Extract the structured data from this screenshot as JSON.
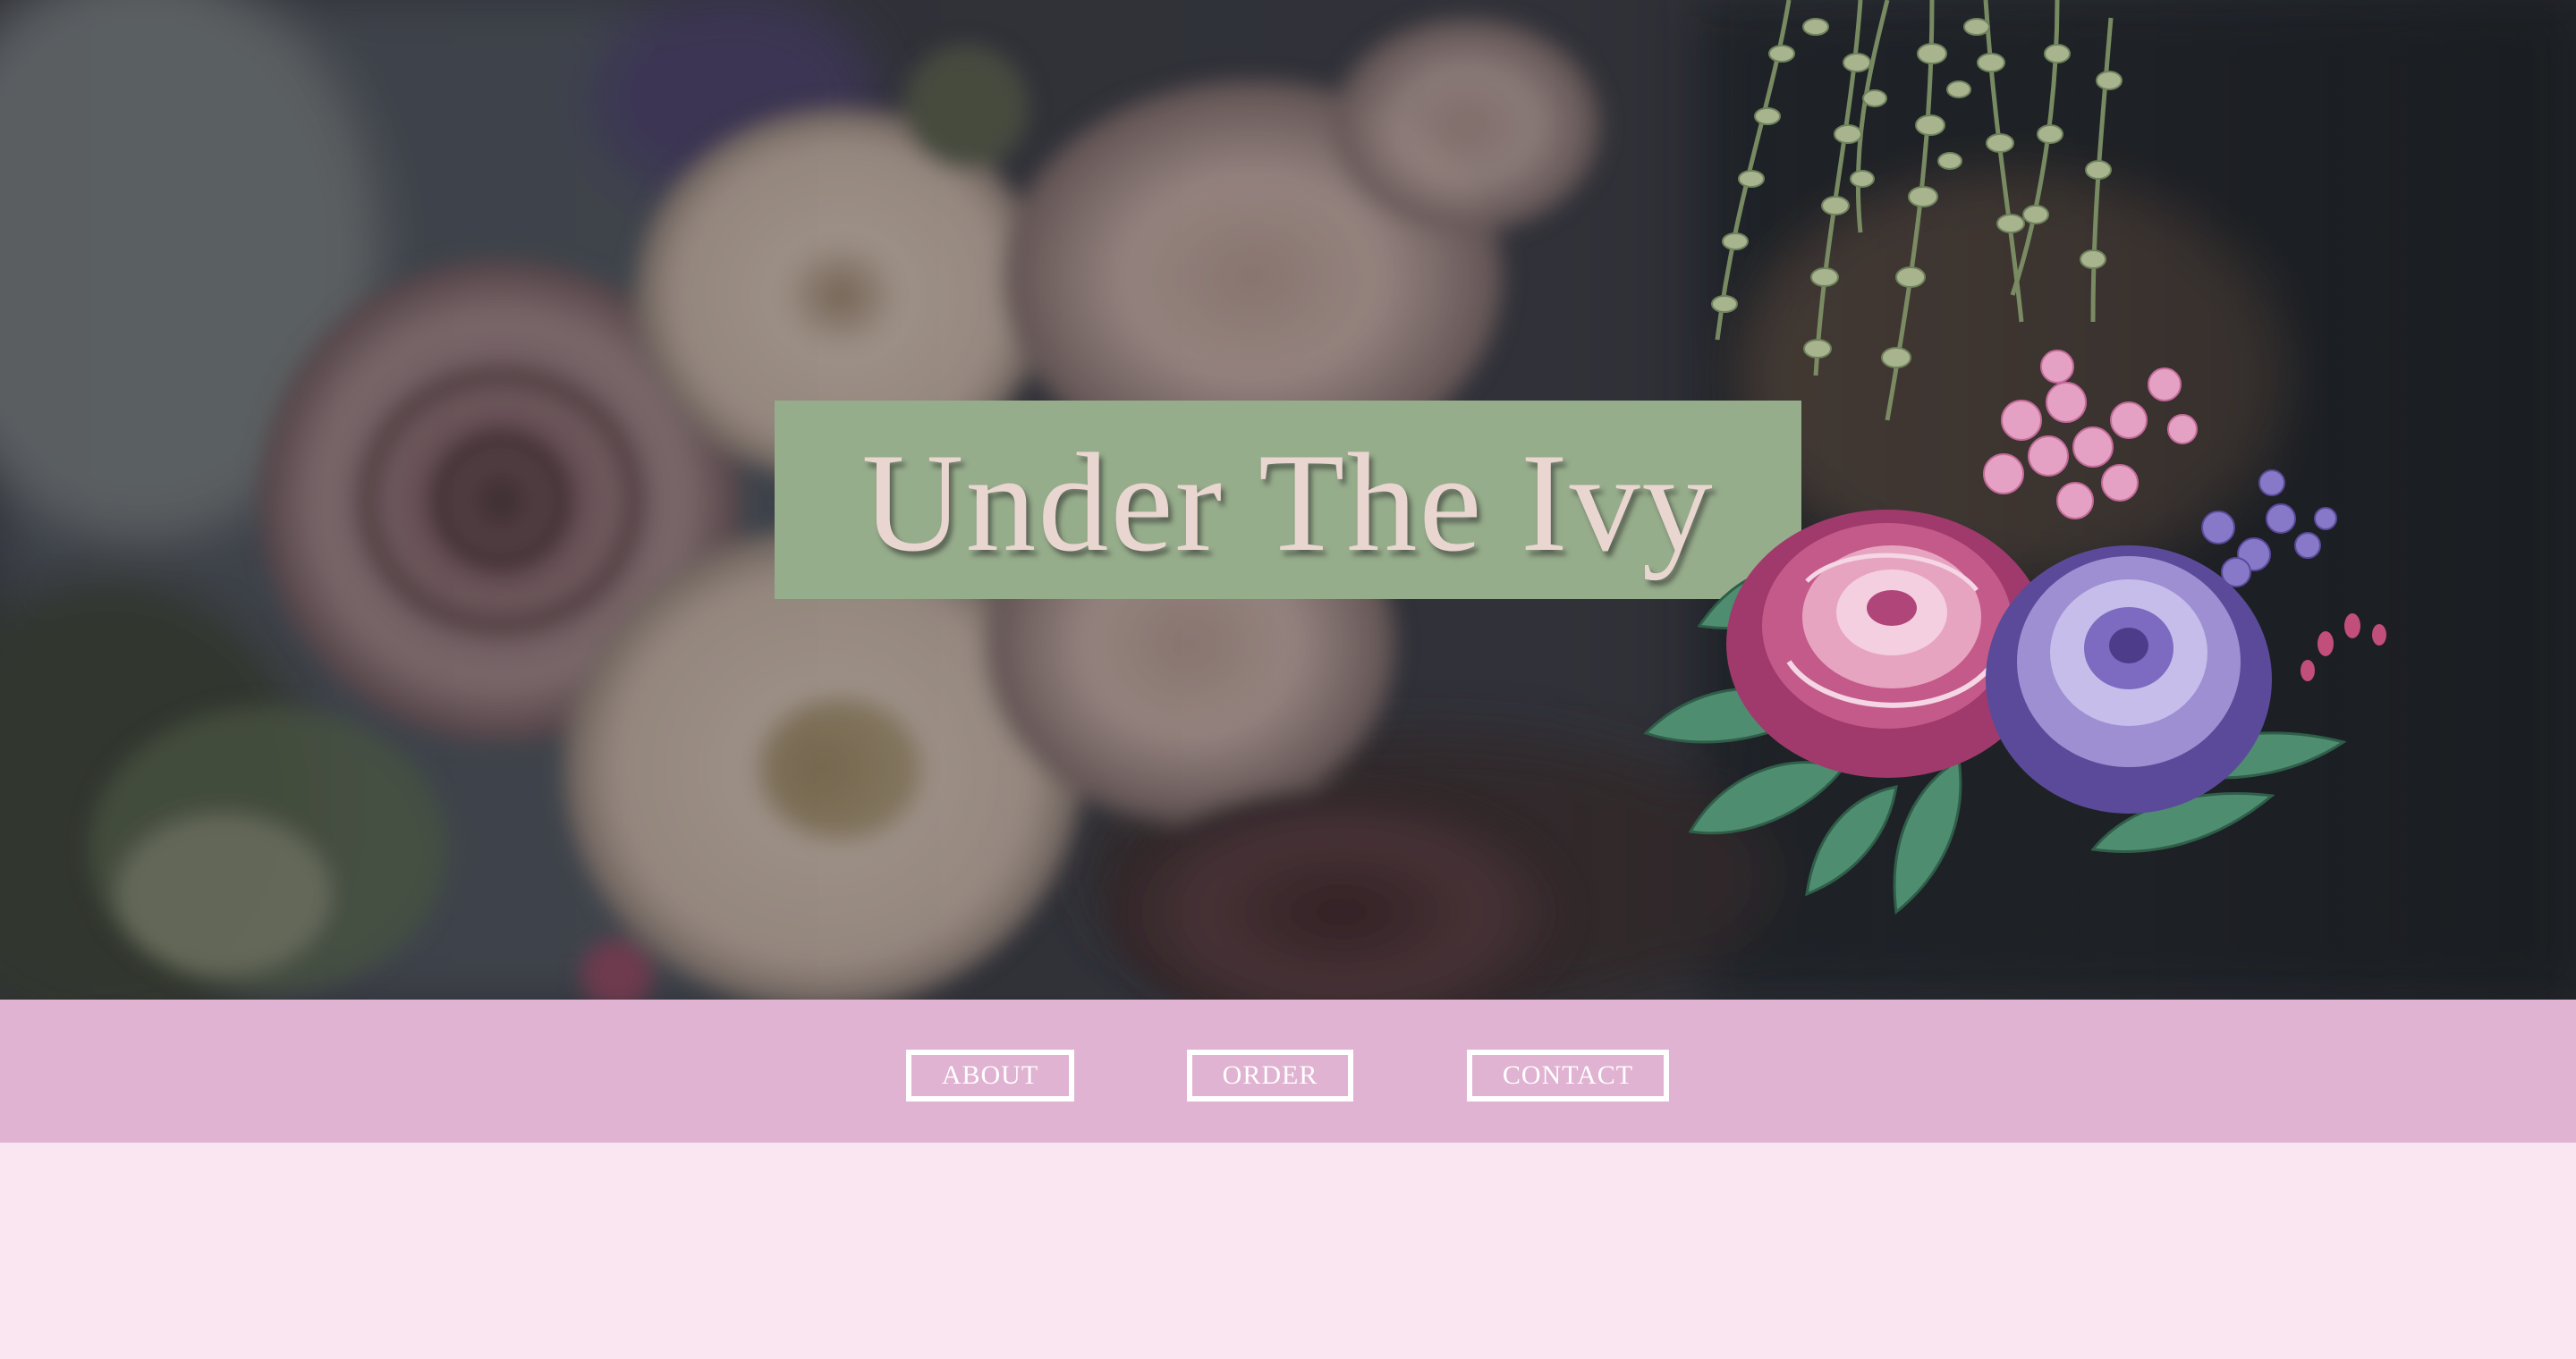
{
  "hero": {
    "title": "Under The Ivy",
    "title_box_color": "#96ad8b",
    "title_text_color": "#ead6d0"
  },
  "nav": {
    "background_color": "#e0b3d2",
    "items": [
      {
        "label": "ABOUT"
      },
      {
        "label": "ORDER"
      },
      {
        "label": "CONTACT"
      }
    ]
  },
  "page": {
    "background_color": "#fae6f1"
  }
}
